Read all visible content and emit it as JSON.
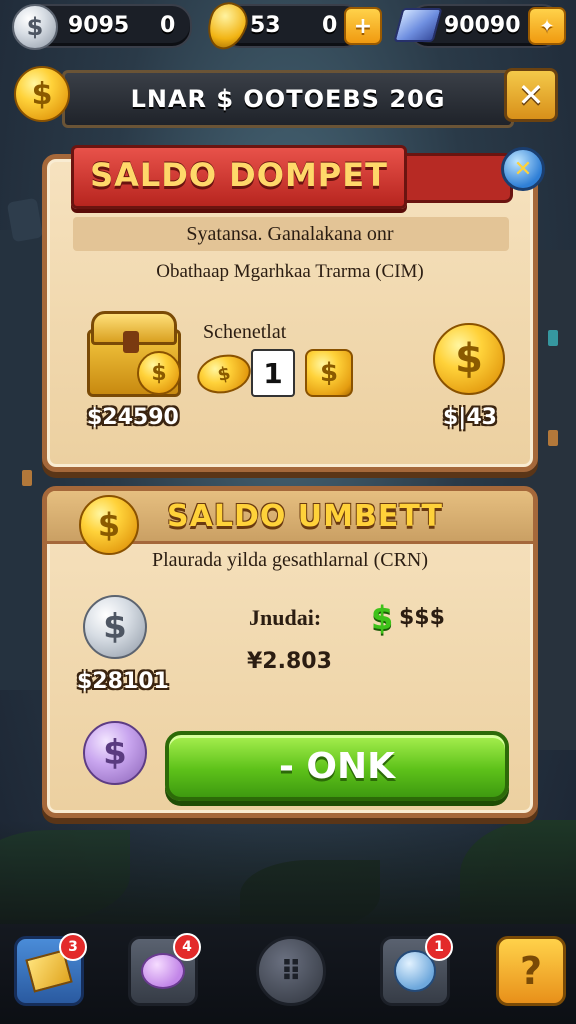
{
  "resources": [
    {
      "icon": "silver-coin-icon",
      "value": "9095",
      "extra": "0"
    },
    {
      "icon": "gold-gem-icon",
      "value": "53",
      "extra": "0"
    },
    {
      "icon": "blue-crystal-icon",
      "value": "90090"
    }
  ],
  "title_bar": {
    "icon": "gold-coin-icon",
    "title": "LNAR $ OOTOEBS 20G",
    "close_icon": "close-icon"
  },
  "panel1": {
    "header": "SALDO DOMPET",
    "line1": "Syatansa. Ganalakana onr",
    "line2": "Obathaap Mgarhkaa Trarma (CIM)",
    "chest_amount": "$24590",
    "subtitle": "Schenetlat",
    "counter": "1",
    "right_amount": "$|43",
    "icon": "treasure-chest-icon"
  },
  "panel2": {
    "header": "SALDO UMBETT",
    "line1": "Plaurada yilda gesathlarnal (CRN)",
    "silver_amount": "$28101",
    "label": "Jnudai:",
    "cash_text": "$$$",
    "value": "¥2.803",
    "button_label": "- ONK"
  },
  "bottom_nav": [
    {
      "icon": "mail-icon",
      "badge": "3"
    },
    {
      "icon": "chat-icon",
      "badge": "4"
    },
    {
      "icon": "menu-grid-icon",
      "badge": ""
    },
    {
      "icon": "globe-icon",
      "badge": "1"
    },
    {
      "icon": "help-icon",
      "badge": ""
    }
  ],
  "colors": {
    "panel_border": "#a5683a",
    "ribbon_red": "#c22e28",
    "accent_gold": "#ffd23a",
    "button_green": "#5ec21a"
  }
}
